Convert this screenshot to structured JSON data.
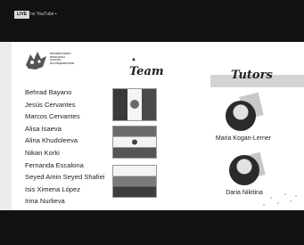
{
  "player": {
    "live_badge": "LIVE",
    "channel_label": "no YouTube •"
  },
  "slide": {
    "logo": {
      "line1": "INTERNATIONAL",
      "line2": "RESEARCH",
      "line3": "SCHOOL",
      "line4": "ИССЛЕДОВАТЕЛИ"
    },
    "team_title": "Team",
    "tutors_title": "Tutors",
    "team_members": [
      "Behrad Bayano",
      "Jesús Cervantes",
      "Marcos Cervantes",
      "Alisa Isaeva",
      "Alina Khudoleeva",
      "Nikan Korki",
      "Fernanda Escalona",
      "Seyed Amin Seyed Shafiei",
      "Isis Ximena López",
      "Irina Nurlieva"
    ],
    "flags": [
      "mexico-flag",
      "iran-flag",
      "russia-flag"
    ],
    "tutors": [
      {
        "name": "Maria Kogan-Lerner"
      },
      {
        "name": "Daria Nikitina"
      }
    ]
  }
}
